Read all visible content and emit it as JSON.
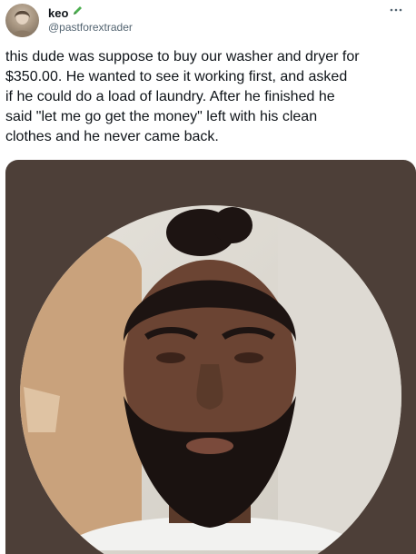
{
  "tweet": {
    "display_name": "keo",
    "handle": "@pastforextrader",
    "text": "this dude was suppose to buy our washer and dryer for\n$350.00. He wanted to see it working first, and asked\nif he could do a load of laundry. After he finished he\nsaid \"let me go get the money\" left with his clean\nclothes and he never came back."
  },
  "icons": {
    "badge": "pencil-icon",
    "more": "more-icon"
  },
  "colors": {
    "text": "#0f1419",
    "secondary": "#536471",
    "badge_green": "#4caf50",
    "media_background": "#4d3f38"
  }
}
